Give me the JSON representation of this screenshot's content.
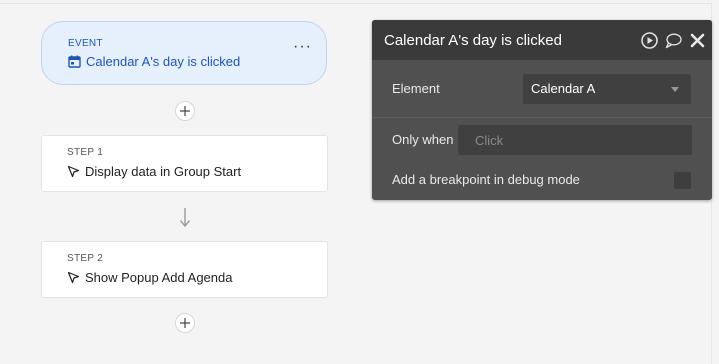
{
  "event": {
    "label": "EVENT",
    "title": "Calendar A's day is clicked",
    "more": "···",
    "icon": "calendar-icon"
  },
  "steps": [
    {
      "label": "STEP 1",
      "title": "Display data in Group Start",
      "icon": "cursor-pointer-icon"
    },
    {
      "label": "STEP 2",
      "title": "Show Popup Add Agenda",
      "icon": "cursor-pointer-icon"
    }
  ],
  "panel": {
    "title": "Calendar A's day is clicked",
    "header_icons": [
      "play-icon",
      "comment-icon",
      "close-icon"
    ],
    "element_label": "Element",
    "element_value": "Calendar A",
    "only_when_label": "Only when",
    "only_when_placeholder": "Click",
    "breakpoint_label": "Add a breakpoint in debug mode"
  },
  "colors": {
    "event_bg": "#e6effc",
    "event_text": "#1e56b6",
    "panel_bg": "#505050",
    "panel_header": "#3a3a3a"
  }
}
